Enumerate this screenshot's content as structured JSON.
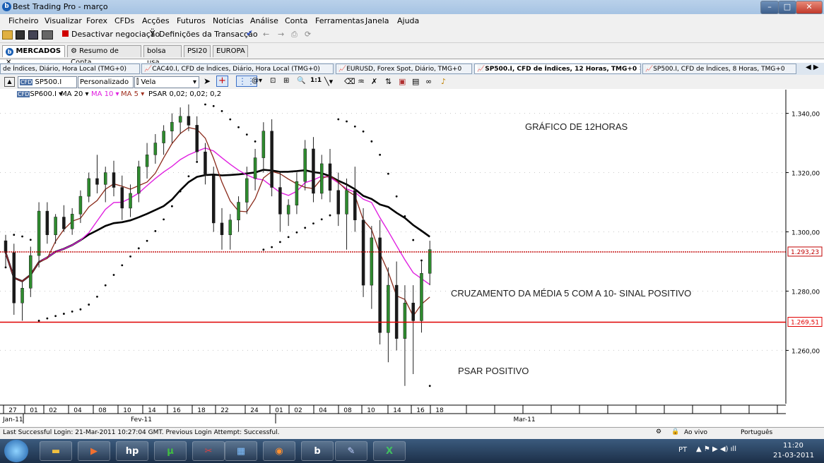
{
  "window": {
    "title": "Best Trading Pro - março"
  },
  "menu": [
    "Ficheiro",
    "Visualizar",
    "Forex",
    "CFDs",
    "Acções",
    "Futuros",
    "Notícias",
    "Análise",
    "Conta",
    "Ferramentas",
    "Janela",
    "Ajuda"
  ],
  "toolbar": {
    "deactivate": "Desactivar negociação",
    "settings": "Definições da Transacção"
  },
  "main_tabs": [
    "MERCADOS",
    "Resumo de Conta",
    "bolsa usa",
    "PSI20",
    "EUROPA"
  ],
  "chart_tabs": [
    "de Índices, Diário, Hora Local (TMG+0)",
    "CAC40.I, CFD de Índices, Diário, Hora Local (TMG+0)",
    "EURUSD, Forex Spot, Diário, TMG+0",
    "SP500.I, CFD de Índices, 12 Horas, TMG+0",
    "SP500.I, CFD de Índices, 8 Horas, TMG+0"
  ],
  "chart_toolbar": {
    "symbol": "SP500.I",
    "template": "Personalizado",
    "chart_type": "Vela"
  },
  "indicators": {
    "sym": "SP600.I",
    "ma20": "MA 20",
    "ma10": "MA 10",
    "ma5": "MA 5",
    "psar": "PSAR 0,02; 0,02; 0,2"
  },
  "chart_data": {
    "type": "candlestick",
    "y_ticks": [
      "1.340,00",
      "1.320,00",
      "1.300,00",
      "1.280,00",
      "1.260,00"
    ],
    "y_tick_values": [
      1340,
      1320,
      1300,
      1280,
      1260
    ],
    "ylim": [
      1242,
      1348
    ],
    "price_lines": [
      {
        "label": "1.293,23",
        "value": 1293.23,
        "color": "#c00000",
        "style": "dotted"
      },
      {
        "label": "1.269,51",
        "value": 1269.51,
        "color": "#e00000",
        "style": "solid"
      }
    ],
    "x_ticks": [
      "27",
      "01",
      "02",
      "04",
      "08",
      "10",
      "14",
      "16",
      "18",
      "22",
      "24",
      "01",
      "02",
      "04",
      "08",
      "10",
      "14",
      "16",
      "18"
    ],
    "months": [
      "Jan-11",
      "Fev-11",
      "Mar-11"
    ],
    "annotations": [
      "GRÁFICO DE 12HORAS",
      "CRUZAMENTO DA MÉDIA 5 COM A 10- SINAL POSITIVO",
      "PSAR POSITIVO"
    ],
    "candles": [
      [
        1297,
        1299,
        1288,
        1293
      ],
      [
        1293,
        1296,
        1272,
        1276
      ],
      [
        1276,
        1283,
        1270,
        1281
      ],
      [
        1281,
        1295,
        1278,
        1292
      ],
      [
        1292,
        1310,
        1288,
        1307
      ],
      [
        1307,
        1310,
        1296,
        1299
      ],
      [
        1299,
        1306,
        1296,
        1305
      ],
      [
        1305,
        1309,
        1300,
        1301
      ],
      [
        1301,
        1308,
        1299,
        1306
      ],
      [
        1306,
        1314,
        1303,
        1312
      ],
      [
        1312,
        1320,
        1310,
        1318
      ],
      [
        1318,
        1326,
        1313,
        1316
      ],
      [
        1316,
        1322,
        1310,
        1320
      ],
      [
        1320,
        1324,
        1312,
        1315
      ],
      [
        1315,
        1319,
        1304,
        1308
      ],
      [
        1308,
        1316,
        1305,
        1313
      ],
      [
        1313,
        1324,
        1310,
        1322
      ],
      [
        1322,
        1330,
        1318,
        1326
      ],
      [
        1326,
        1333,
        1323,
        1330
      ],
      [
        1330,
        1336,
        1326,
        1334
      ],
      [
        1334,
        1340,
        1330,
        1337
      ],
      [
        1337,
        1342,
        1333,
        1339
      ],
      [
        1339,
        1343,
        1334,
        1336
      ],
      [
        1336,
        1339,
        1324,
        1327
      ],
      [
        1327,
        1330,
        1316,
        1319
      ],
      [
        1319,
        1322,
        1300,
        1303
      ],
      [
        1303,
        1308,
        1294,
        1299
      ],
      [
        1299,
        1306,
        1294,
        1304
      ],
      [
        1304,
        1312,
        1300,
        1310
      ],
      [
        1310,
        1322,
        1306,
        1318
      ],
      [
        1318,
        1328,
        1314,
        1325
      ],
      [
        1325,
        1337,
        1320,
        1334
      ],
      [
        1334,
        1338,
        1312,
        1315
      ],
      [
        1315,
        1320,
        1300,
        1306
      ],
      [
        1306,
        1311,
        1302,
        1309
      ],
      [
        1309,
        1320,
        1306,
        1317
      ],
      [
        1317,
        1331,
        1314,
        1328
      ],
      [
        1328,
        1332,
        1310,
        1313
      ],
      [
        1313,
        1326,
        1311,
        1323
      ],
      [
        1323,
        1328,
        1310,
        1314
      ],
      [
        1314,
        1320,
        1302,
        1306
      ],
      [
        1306,
        1318,
        1294,
        1314
      ],
      [
        1314,
        1322,
        1300,
        1304
      ],
      [
        1304,
        1308,
        1278,
        1282
      ],
      [
        1282,
        1302,
        1274,
        1298
      ],
      [
        1298,
        1304,
        1262,
        1266
      ],
      [
        1266,
        1288,
        1256,
        1282
      ],
      [
        1282,
        1290,
        1260,
        1264
      ],
      [
        1264,
        1282,
        1248,
        1276
      ],
      [
        1276,
        1282,
        1252,
        1270
      ],
      [
        1270,
        1290,
        1266,
        1286
      ],
      [
        1286,
        1297,
        1282,
        1294
      ]
    ]
  },
  "status": {
    "login": "Last Successful Login: 21-Mar-2011 10:27:04 GMT. Previous Login Attempt: Successful.",
    "live": "Ao vivo",
    "lang": "Português"
  },
  "taskbar": {
    "lang": "PT",
    "time": "11:20",
    "date": "21-03-2011"
  }
}
